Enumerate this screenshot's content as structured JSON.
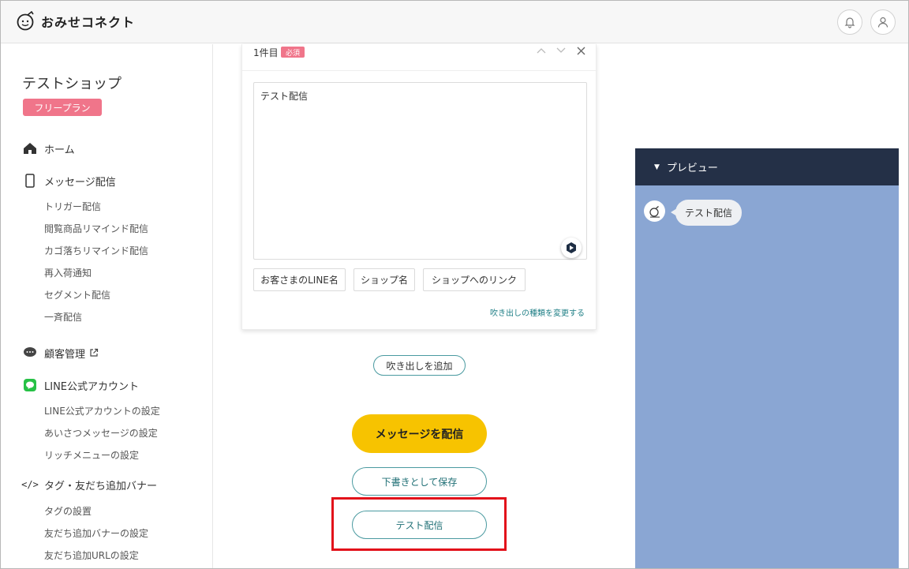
{
  "header": {
    "brand": "おみせコネクト",
    "icons": {
      "bell": "bell-icon",
      "user": "user-icon",
      "logo": "logo-icon"
    }
  },
  "sidebar": {
    "shop_name": "テストショップ",
    "plan": "フリープラン",
    "home": "ホーム",
    "message": {
      "label": "メッセージ配信",
      "items": [
        "トリガー配信",
        "閲覧商品リマインド配信",
        "カゴ落ちリマインド配信",
        "再入荷通知",
        "セグメント配信",
        "一斉配信"
      ]
    },
    "customers": "顧客管理",
    "line": {
      "label": "LINE公式アカウント",
      "items": [
        "LINE公式アカウントの設定",
        "あいさつメッセージの設定",
        "リッチメニューの設定"
      ]
    },
    "tags": {
      "label": "タグ・友だち追加バナー",
      "items": [
        "タグの設置",
        "友だち追加バナーの設定",
        "友だち追加URLの設定"
      ]
    }
  },
  "composer": {
    "title": "1件目",
    "required": "必須",
    "message_text": "テスト配信",
    "insert_buttons": [
      "お客さまのLINE名",
      "ショップ名",
      "ショップへのリンク"
    ],
    "change_bubble_type": "吹き出しの種類を変更する",
    "add_bubble": "吹き出しを追加"
  },
  "actions": {
    "send": "メッセージを配信",
    "save_draft": "下書きとして保存",
    "test_send": "テスト配信"
  },
  "preview": {
    "title": "プレビュー",
    "bubble_text": "テスト配信"
  },
  "colors": {
    "accent_pink": "#f0758a",
    "send_yellow": "#f7c300",
    "teal": "#4a9aa0",
    "preview_header": "#243047",
    "preview_bg": "#8aa6d3",
    "highlight_red": "#e2111a"
  }
}
